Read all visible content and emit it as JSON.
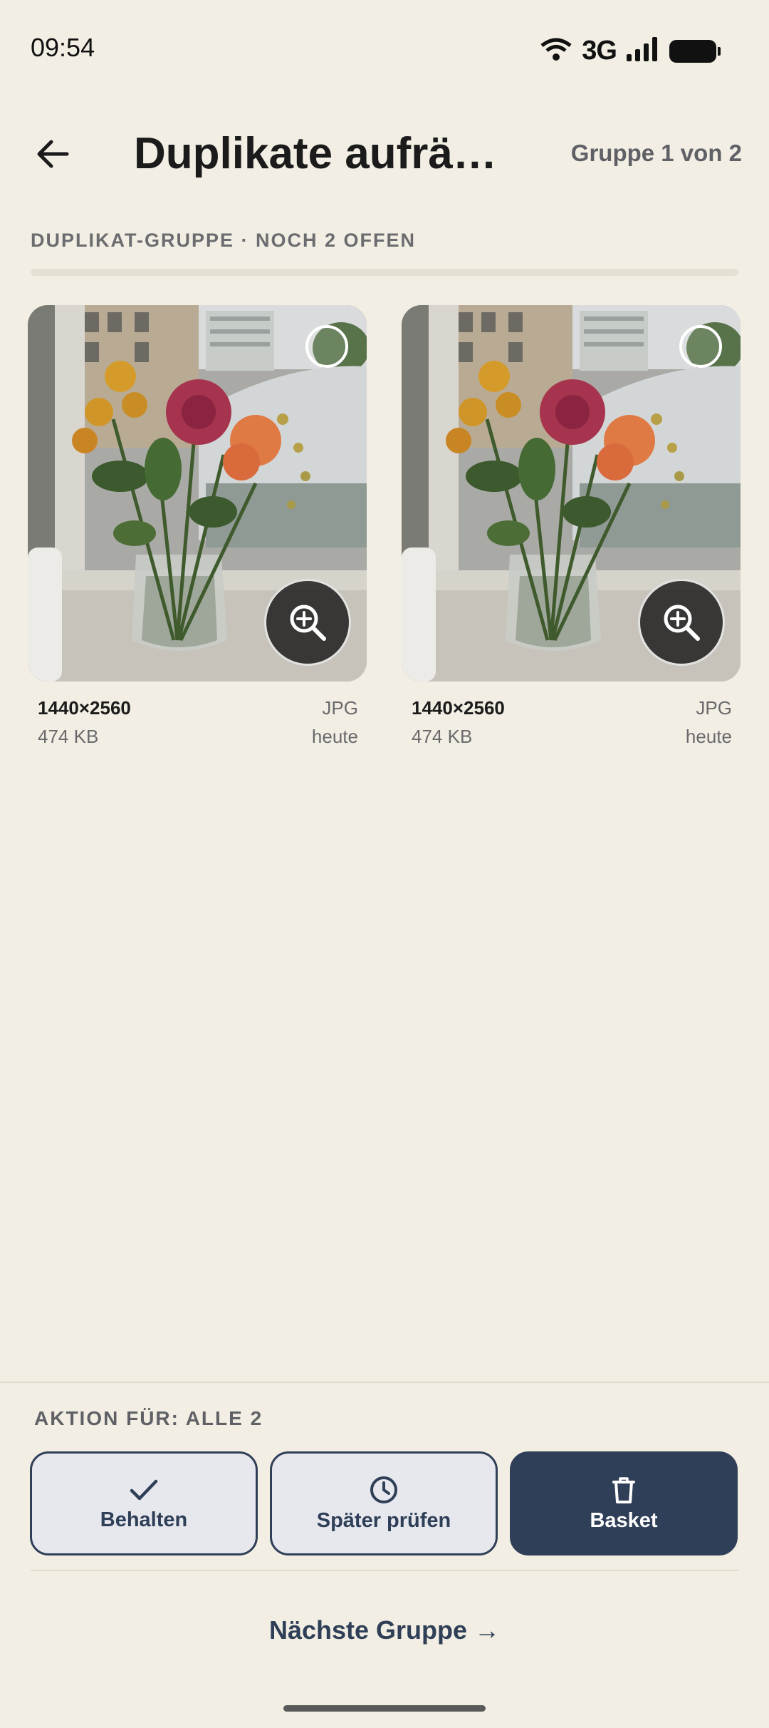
{
  "status_bar": {
    "time": "09:54",
    "network": "3G",
    "icons": [
      "wifi-icon",
      "signal-icon",
      "battery-icon"
    ]
  },
  "header": {
    "title": "Duplikate aufräu…",
    "group_counter": "Gruppe 1 von 2",
    "back_icon": "arrow-left-icon"
  },
  "section": {
    "label": "DUPLIKAT-GRUPPE · NOCH 2 OFFEN",
    "progress_fraction": 0
  },
  "photos": [
    {
      "resolution": "1440×2560",
      "size": "474 KB",
      "type": "JPG",
      "date": "heute",
      "selected": false
    },
    {
      "resolution": "1440×2560",
      "size": "474 KB",
      "type": "JPG",
      "date": "heute",
      "selected": false
    }
  ],
  "actions": {
    "label": "AKTION FÜR: ALLE 2",
    "keep": "Behalten",
    "later": "Später prüfen",
    "basket": "Basket",
    "next_group": "Nächste Gruppe →"
  },
  "colors": {
    "background": "#f2eee4",
    "accent": "#2f3f57",
    "muted_text": "#6a6a6d"
  }
}
